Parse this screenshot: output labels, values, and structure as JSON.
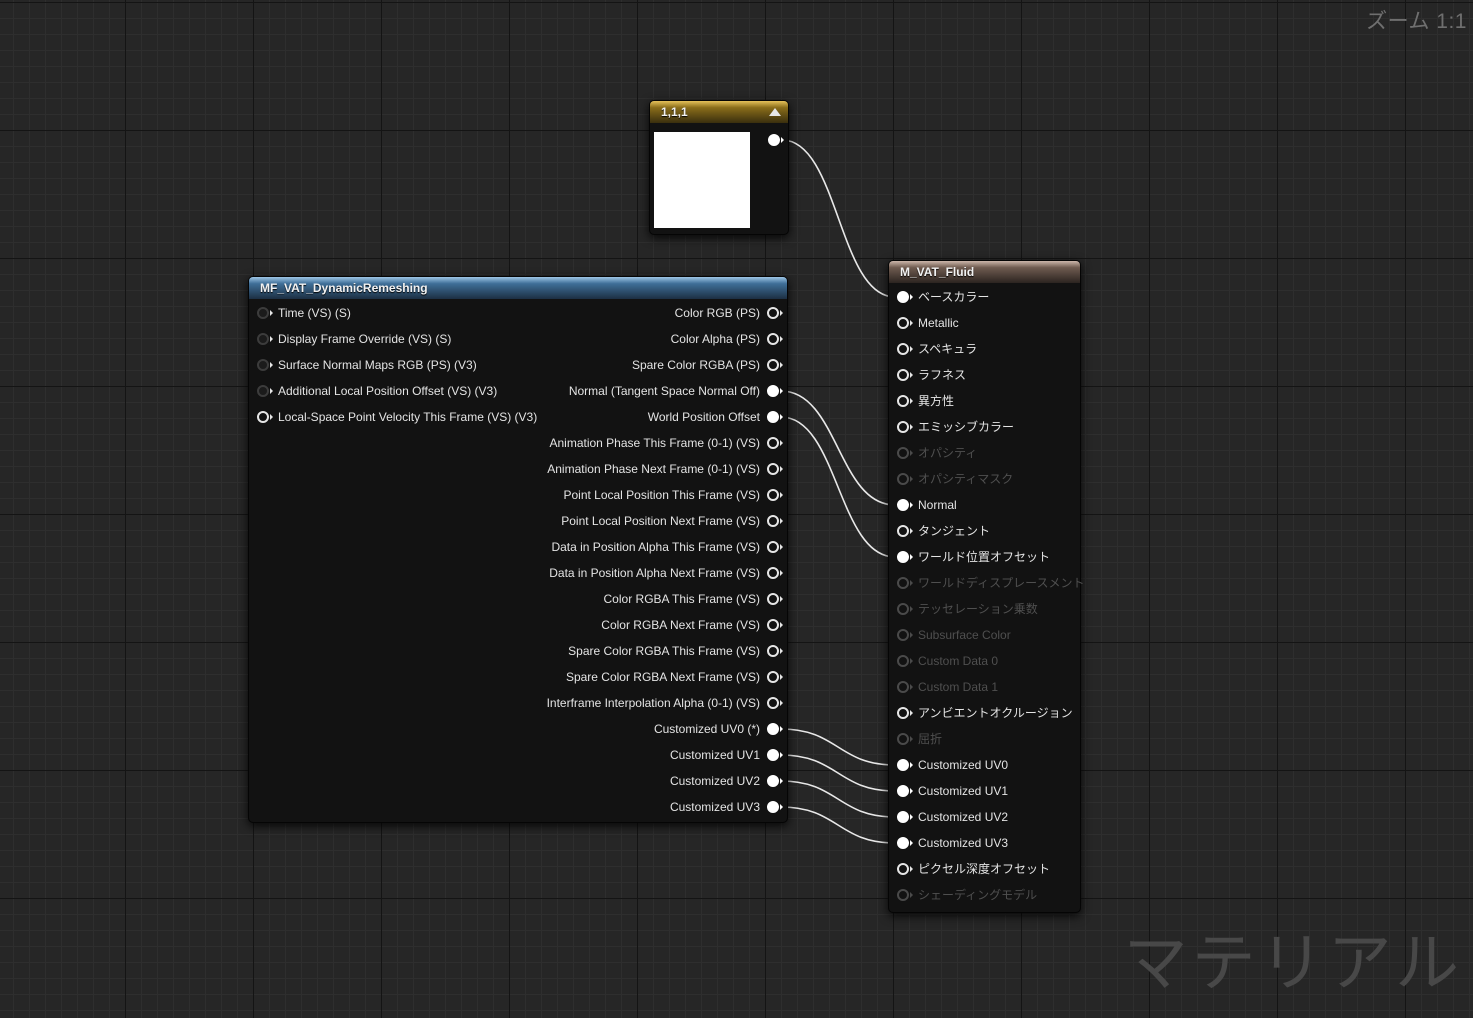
{
  "zoom_label": "ズーム 1:1",
  "watermark": "マテリアル",
  "constant_node": {
    "title": "1,1,1",
    "preview_color": "#ffffff"
  },
  "function_node": {
    "title": "MF_VAT_DynamicRemeshing",
    "inputs": [
      {
        "label": "Time (VS) (S)",
        "connected": false,
        "style": "faint"
      },
      {
        "label": "Display Frame Override (VS) (S)",
        "connected": false,
        "style": "faint"
      },
      {
        "label": "Surface Normal Maps RGB (PS) (V3)",
        "connected": false,
        "style": "faint"
      },
      {
        "label": "Additional Local Position Offset (VS) (V3)",
        "connected": false,
        "style": "faint"
      },
      {
        "label": "Local-Space Point Velocity This Frame (VS) (V3)",
        "connected": false,
        "style": "normal"
      }
    ],
    "outputs": [
      {
        "label": "Color RGB (PS)",
        "connected": false
      },
      {
        "label": "Color Alpha (PS)",
        "connected": false
      },
      {
        "label": "Spare Color RGBA (PS)",
        "connected": false
      },
      {
        "label": "Normal (Tangent Space Normal Off)",
        "connected": true
      },
      {
        "label": "World Position Offset",
        "connected": true
      },
      {
        "label": "Animation Phase This Frame (0-1) (VS)",
        "connected": false
      },
      {
        "label": "Animation Phase Next Frame (0-1) (VS)",
        "connected": false
      },
      {
        "label": "Point Local Position This Frame (VS)",
        "connected": false
      },
      {
        "label": "Point Local Position Next Frame (VS)",
        "connected": false
      },
      {
        "label": "Data in Position Alpha This Frame (VS)",
        "connected": false
      },
      {
        "label": "Data in Position Alpha Next Frame (VS)",
        "connected": false
      },
      {
        "label": "Color RGBA This Frame (VS)",
        "connected": false
      },
      {
        "label": "Color RGBA Next Frame (VS)",
        "connected": false
      },
      {
        "label": "Spare Color RGBA This Frame (VS)",
        "connected": false
      },
      {
        "label": "Spare Color RGBA Next Frame (VS)",
        "connected": false
      },
      {
        "label": "Interframe Interpolation Alpha (0-1) (VS)",
        "connected": false
      },
      {
        "label": "Customized UV0 (*)",
        "connected": true
      },
      {
        "label": "Customized UV1",
        "connected": true
      },
      {
        "label": "Customized UV2",
        "connected": true
      },
      {
        "label": "Customized UV3",
        "connected": true
      }
    ]
  },
  "material_node": {
    "title": "M_VAT_Fluid",
    "inputs": [
      {
        "label": "ベースカラー",
        "connected": true,
        "enabled": true
      },
      {
        "label": "Metallic",
        "connected": false,
        "enabled": true
      },
      {
        "label": "スペキュラ",
        "connected": false,
        "enabled": true
      },
      {
        "label": "ラフネス",
        "connected": false,
        "enabled": true
      },
      {
        "label": "異方性",
        "connected": false,
        "enabled": true
      },
      {
        "label": "エミッシブカラー",
        "connected": false,
        "enabled": true
      },
      {
        "label": "オパシティ",
        "connected": false,
        "enabled": false
      },
      {
        "label": "オパシティマスク",
        "connected": false,
        "enabled": false
      },
      {
        "label": "Normal",
        "connected": true,
        "enabled": true
      },
      {
        "label": "タンジェント",
        "connected": false,
        "enabled": true
      },
      {
        "label": "ワールド位置オフセット",
        "connected": true,
        "enabled": true
      },
      {
        "label": "ワールドディスプレースメント",
        "connected": false,
        "enabled": false
      },
      {
        "label": "テッセレーション乗数",
        "connected": false,
        "enabled": false
      },
      {
        "label": "Subsurface Color",
        "connected": false,
        "enabled": false
      },
      {
        "label": "Custom Data 0",
        "connected": false,
        "enabled": false
      },
      {
        "label": "Custom Data 1",
        "connected": false,
        "enabled": false
      },
      {
        "label": "アンビエントオクルージョン",
        "connected": false,
        "enabled": true
      },
      {
        "label": "屈折",
        "connected": false,
        "enabled": false
      },
      {
        "label": "Customized UV0",
        "connected": true,
        "enabled": true
      },
      {
        "label": "Customized UV1",
        "connected": true,
        "enabled": true
      },
      {
        "label": "Customized UV2",
        "connected": true,
        "enabled": true
      },
      {
        "label": "Customized UV3",
        "connected": true,
        "enabled": true
      },
      {
        "label": "ピクセル深度オフセット",
        "connected": false,
        "enabled": true
      },
      {
        "label": "シェーディングモデル",
        "connected": false,
        "enabled": false
      }
    ]
  },
  "connections": [
    {
      "from": "1,1,1",
      "to": "ベースカラー"
    },
    {
      "from": "Normal (Tangent Space Normal Off)",
      "to": "Normal"
    },
    {
      "from": "World Position Offset",
      "to": "ワールド位置オフセット"
    },
    {
      "from": "Customized UV0 (*)",
      "to": "Customized UV0"
    },
    {
      "from": "Customized UV1",
      "to": "Customized UV1"
    },
    {
      "from": "Customized UV2",
      "to": "Customized UV2"
    },
    {
      "from": "Customized UV3",
      "to": "Customized UV3"
    }
  ],
  "colors": {
    "wire": "#e8e8e8",
    "constant_header": "#c9a53c",
    "function_header": "#4f82ad",
    "material_header": "#8d776b"
  }
}
